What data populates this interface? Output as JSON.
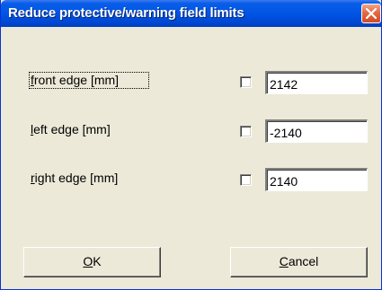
{
  "window": {
    "title": "Reduce protective/warning field limits"
  },
  "fields": [
    {
      "label_accel": "f",
      "label_rest": "ront edge [mm]",
      "checked": false,
      "value": "2142"
    },
    {
      "label_accel": "l",
      "label_rest": "eft edge [mm]",
      "checked": false,
      "value": "-2140"
    },
    {
      "label_accel": "r",
      "label_rest": "ight edge [mm]",
      "checked": false,
      "value": "2140"
    }
  ],
  "buttons": {
    "ok": {
      "accel": "O",
      "rest": "K"
    },
    "cancel": {
      "accel": "C",
      "rest": "ancel"
    }
  },
  "icons": {
    "close": "close-x-icon"
  },
  "colors": {
    "titlebar": "#0055e5",
    "dialog_bg": "#ece9d8",
    "close_button": "#e36b43"
  }
}
